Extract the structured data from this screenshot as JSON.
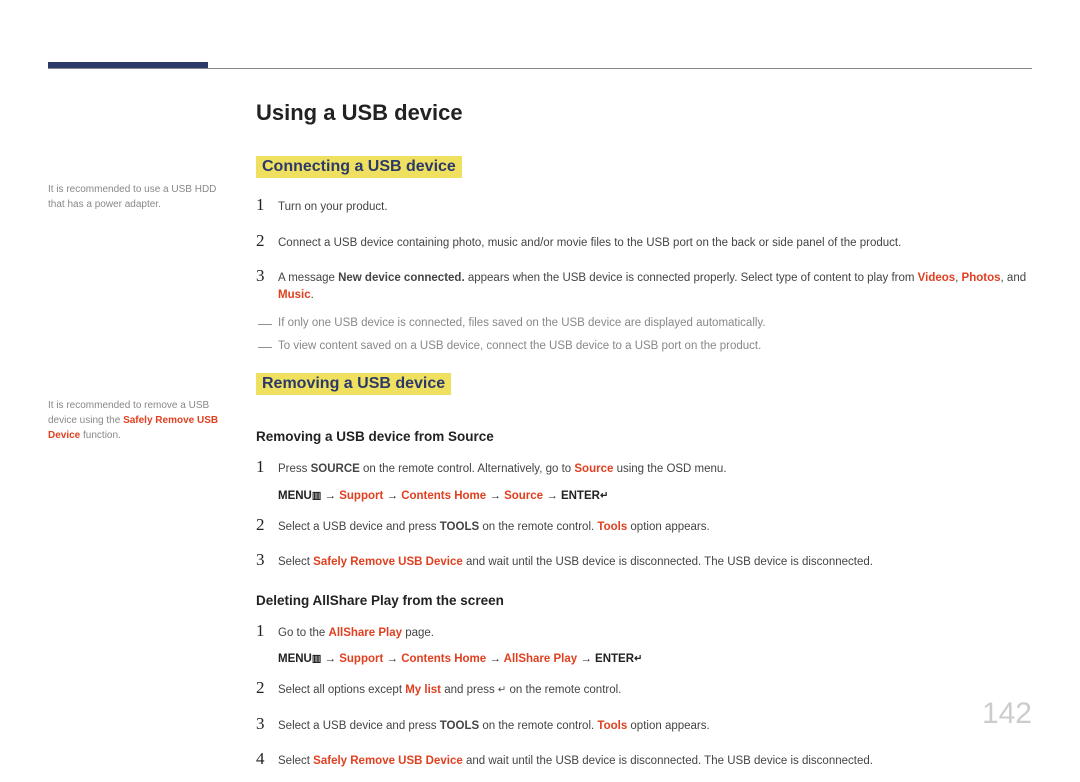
{
  "page_number": "142",
  "title": "Using a USB device",
  "section1": {
    "heading": "Connecting a USB device",
    "sidenote": "It is recommended to use a USB HDD that has a power adapter.",
    "step1_num": "1",
    "step1": "Turn on your product.",
    "step2_num": "2",
    "step2": "Connect a USB device containing photo, music and/or movie files to the USB port on the back or side panel of the product.",
    "step3_num": "3",
    "step3_pre": "A message ",
    "step3_bold": "New device connected.",
    "step3_mid": " appears when the USB device is connected properly. Select type of content to play from ",
    "step3_v": "Videos",
    "step3_c1": ", ",
    "step3_p": "Photos",
    "step3_c2": ", and ",
    "step3_m": "Music",
    "step3_end": ".",
    "note1": "If only one USB device is connected, files saved on the USB device are displayed automatically.",
    "note2": "To view content saved on a USB device, connect the USB device to a USB port on the product."
  },
  "section2": {
    "heading": "Removing a USB device",
    "sidenote_pre": "It is recommended to remove a USB device using the ",
    "sidenote_red": "Safely Remove USB Device",
    "sidenote_post": " function.",
    "sub1": {
      "heading": "Removing a USB device from Source",
      "step1_num": "1",
      "step1_pre": "Press ",
      "step1_bold": "SOURCE",
      "step1_mid": " on the remote control. Alternatively, go to ",
      "step1_red": "Source",
      "step1_post": " using the OSD menu.",
      "nav_menu": "MENU",
      "nav_arrow": " → ",
      "nav_support": "Support",
      "nav_contents": "Contents Home",
      "nav_source": "Source",
      "nav_enter": "ENTER",
      "step2_num": "2",
      "step2_pre": "Select a USB device and press ",
      "step2_bold": "TOOLS",
      "step2_mid": " on the remote control. ",
      "step2_red": "Tools",
      "step2_post": " option appears.",
      "step3_num": "3",
      "step3_pre": "Select ",
      "step3_red": "Safely Remove USB Device",
      "step3_post": " and wait until the USB device is disconnected. The USB device is disconnected."
    },
    "sub2": {
      "heading": "Deleting AllShare Play from the screen",
      "step1_num": "1",
      "step1_pre": "Go to the ",
      "step1_red": "AllShare Play",
      "step1_post": " page.",
      "nav_menu": "MENU",
      "nav_arrow": " → ",
      "nav_support": "Support",
      "nav_contents": "Contents Home",
      "nav_allshare": "AllShare Play",
      "nav_enter": "ENTER",
      "step2_num": "2",
      "step2_pre": "Select all options except ",
      "step2_red": "My list",
      "step2_mid": " and press ",
      "step2_icon": "↵",
      "step2_post": " on the remote control.",
      "step3_num": "3",
      "step3_pre": "Select a USB device and press ",
      "step3_bold": "TOOLS",
      "step3_mid": " on the remote control. ",
      "step3_red": "Tools",
      "step3_post": " option appears.",
      "step4_num": "4",
      "step4_pre": "Select ",
      "step4_red": "Safely Remove USB Device",
      "step4_post": " and wait until the USB device is disconnected. The USB device is disconnected."
    }
  },
  "icons": {
    "menu": "▥",
    "enter": "↵"
  }
}
